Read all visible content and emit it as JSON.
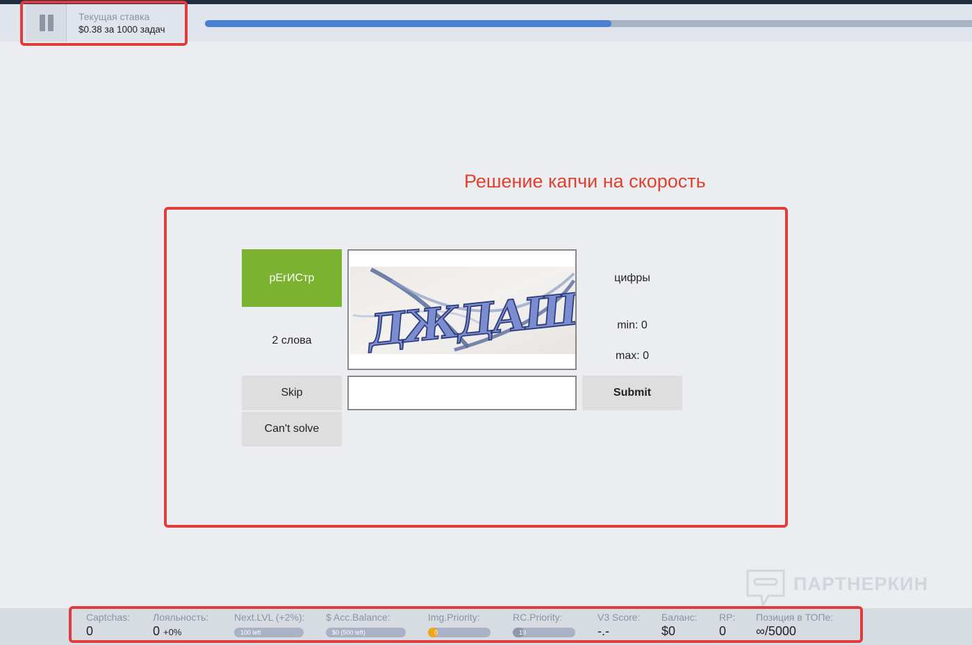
{
  "header": {
    "rate_label": "Текущая ставка",
    "rate_value": "$0.38 за 1000 задач",
    "progress": 0.53
  },
  "annotation": {
    "title": "Решение капчи на скорость"
  },
  "task": {
    "mode_label": "рЕгИСтр",
    "words_label": "2 слова",
    "captcha_text": "ДЖДАШ",
    "type_label": "цифры",
    "min_label": "min: 0",
    "max_label": "max: 0",
    "answer_value": "",
    "skip_label": "Skip",
    "cant_solve_label": "Can't solve",
    "submit_label": "Submit"
  },
  "watermark": {
    "text": "ПАРТНЕРКИН"
  },
  "stats": {
    "captchas": {
      "label": "Captchas:",
      "value": "0"
    },
    "loyalty": {
      "label": "Лояльность:",
      "value": "0",
      "sub": "+0%"
    },
    "next_lvl": {
      "label": "Next.LVL (+2%):",
      "pill": "100 left",
      "level": 0
    },
    "acc_balance": {
      "label": "$ Acc.Balance:",
      "pill": "$0 (500 left)",
      "level": 0
    },
    "img_priority": {
      "label": "Img.Priority:",
      "pill": "0",
      "level": 0.1
    },
    "rc_priority": {
      "label": "RC.Priority:",
      "pill": "19",
      "level": 0.19
    },
    "v3_score": {
      "label": "V3 Score:",
      "value": "-.-"
    },
    "balance": {
      "label": "Баланс:",
      "value": "$0"
    },
    "rp": {
      "label": "RP:",
      "value": "0"
    },
    "top_position": {
      "label": "Позиция в ТОПе:",
      "value": "∞/5000"
    }
  },
  "colors": {
    "accent_green": "#7bb22f",
    "progress_blue": "#4a80d4",
    "highlight_red": "#e23b3b",
    "img_priority_orange": "#f2a516",
    "rc_priority_gray": "#8e98aa"
  }
}
